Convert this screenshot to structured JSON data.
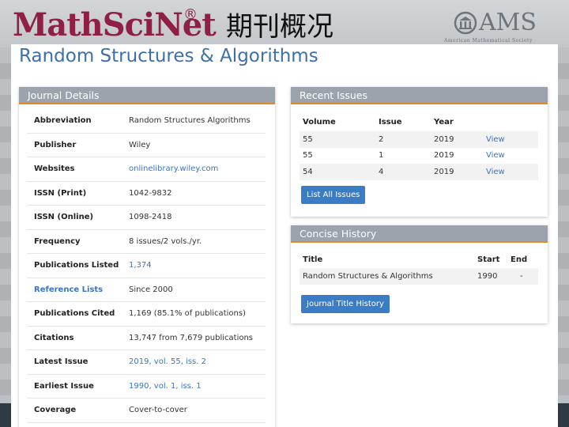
{
  "slide": {
    "logo": "MathSciNet",
    "logo_mark": "®",
    "title": "期刊概况",
    "ams_logo": "AMS",
    "ams_subtitle": "American Mathematical Society"
  },
  "journal": {
    "title": "Random Structures & Algorithms"
  },
  "details": {
    "heading": "Journal Details",
    "rows": [
      {
        "label": "Abbreviation",
        "value": "Random Structures Algorithms"
      },
      {
        "label": "Publisher",
        "value": "Wiley"
      },
      {
        "label": "Websites",
        "value": "onlinelibrary.wiley.com"
      },
      {
        "label": "ISSN (Print)",
        "value": "1042-9832"
      },
      {
        "label": "ISSN (Online)",
        "value": "1098-2418"
      },
      {
        "label": "Frequency",
        "value": "8 issues/2 vols./yr."
      },
      {
        "label": "Publications Listed",
        "value": "1,374"
      },
      {
        "label": "Reference Lists",
        "value": "Since 2000"
      },
      {
        "label": "Publications Cited",
        "value": "1,169 (85.1% of publications)"
      },
      {
        "label": "Citations",
        "value": "13,747 from 7,679 publications"
      },
      {
        "label": "Latest Issue",
        "value": "2019, vol. 55, iss. 2"
      },
      {
        "label": "Earliest Issue",
        "value": "1990, vol. 1, iss. 1"
      },
      {
        "label": "Coverage",
        "value": "Cover-to-cover"
      }
    ]
  },
  "issues": {
    "heading": "Recent Issues",
    "columns": [
      "Volume",
      "Issue",
      "Year",
      ""
    ],
    "rows": [
      {
        "volume": "55",
        "issue": "2",
        "year": "2019",
        "action": "View"
      },
      {
        "volume": "55",
        "issue": "1",
        "year": "2019",
        "action": "View"
      },
      {
        "volume": "54",
        "issue": "4",
        "year": "2019",
        "action": "View"
      }
    ],
    "button": "List All Issues"
  },
  "history": {
    "heading": "Concise History",
    "columns": [
      "Title",
      "Start",
      "End"
    ],
    "rows": [
      {
        "title": "Random Structures & Algorithms",
        "start": "1990",
        "end": "-"
      }
    ],
    "button": "Journal Title History"
  },
  "colors": {
    "logo": "#8f1f45",
    "link": "#3a74c2",
    "panel_header": "#9ba4ad",
    "accent_border": "#e08a2e",
    "button": "#3b7dc4"
  }
}
